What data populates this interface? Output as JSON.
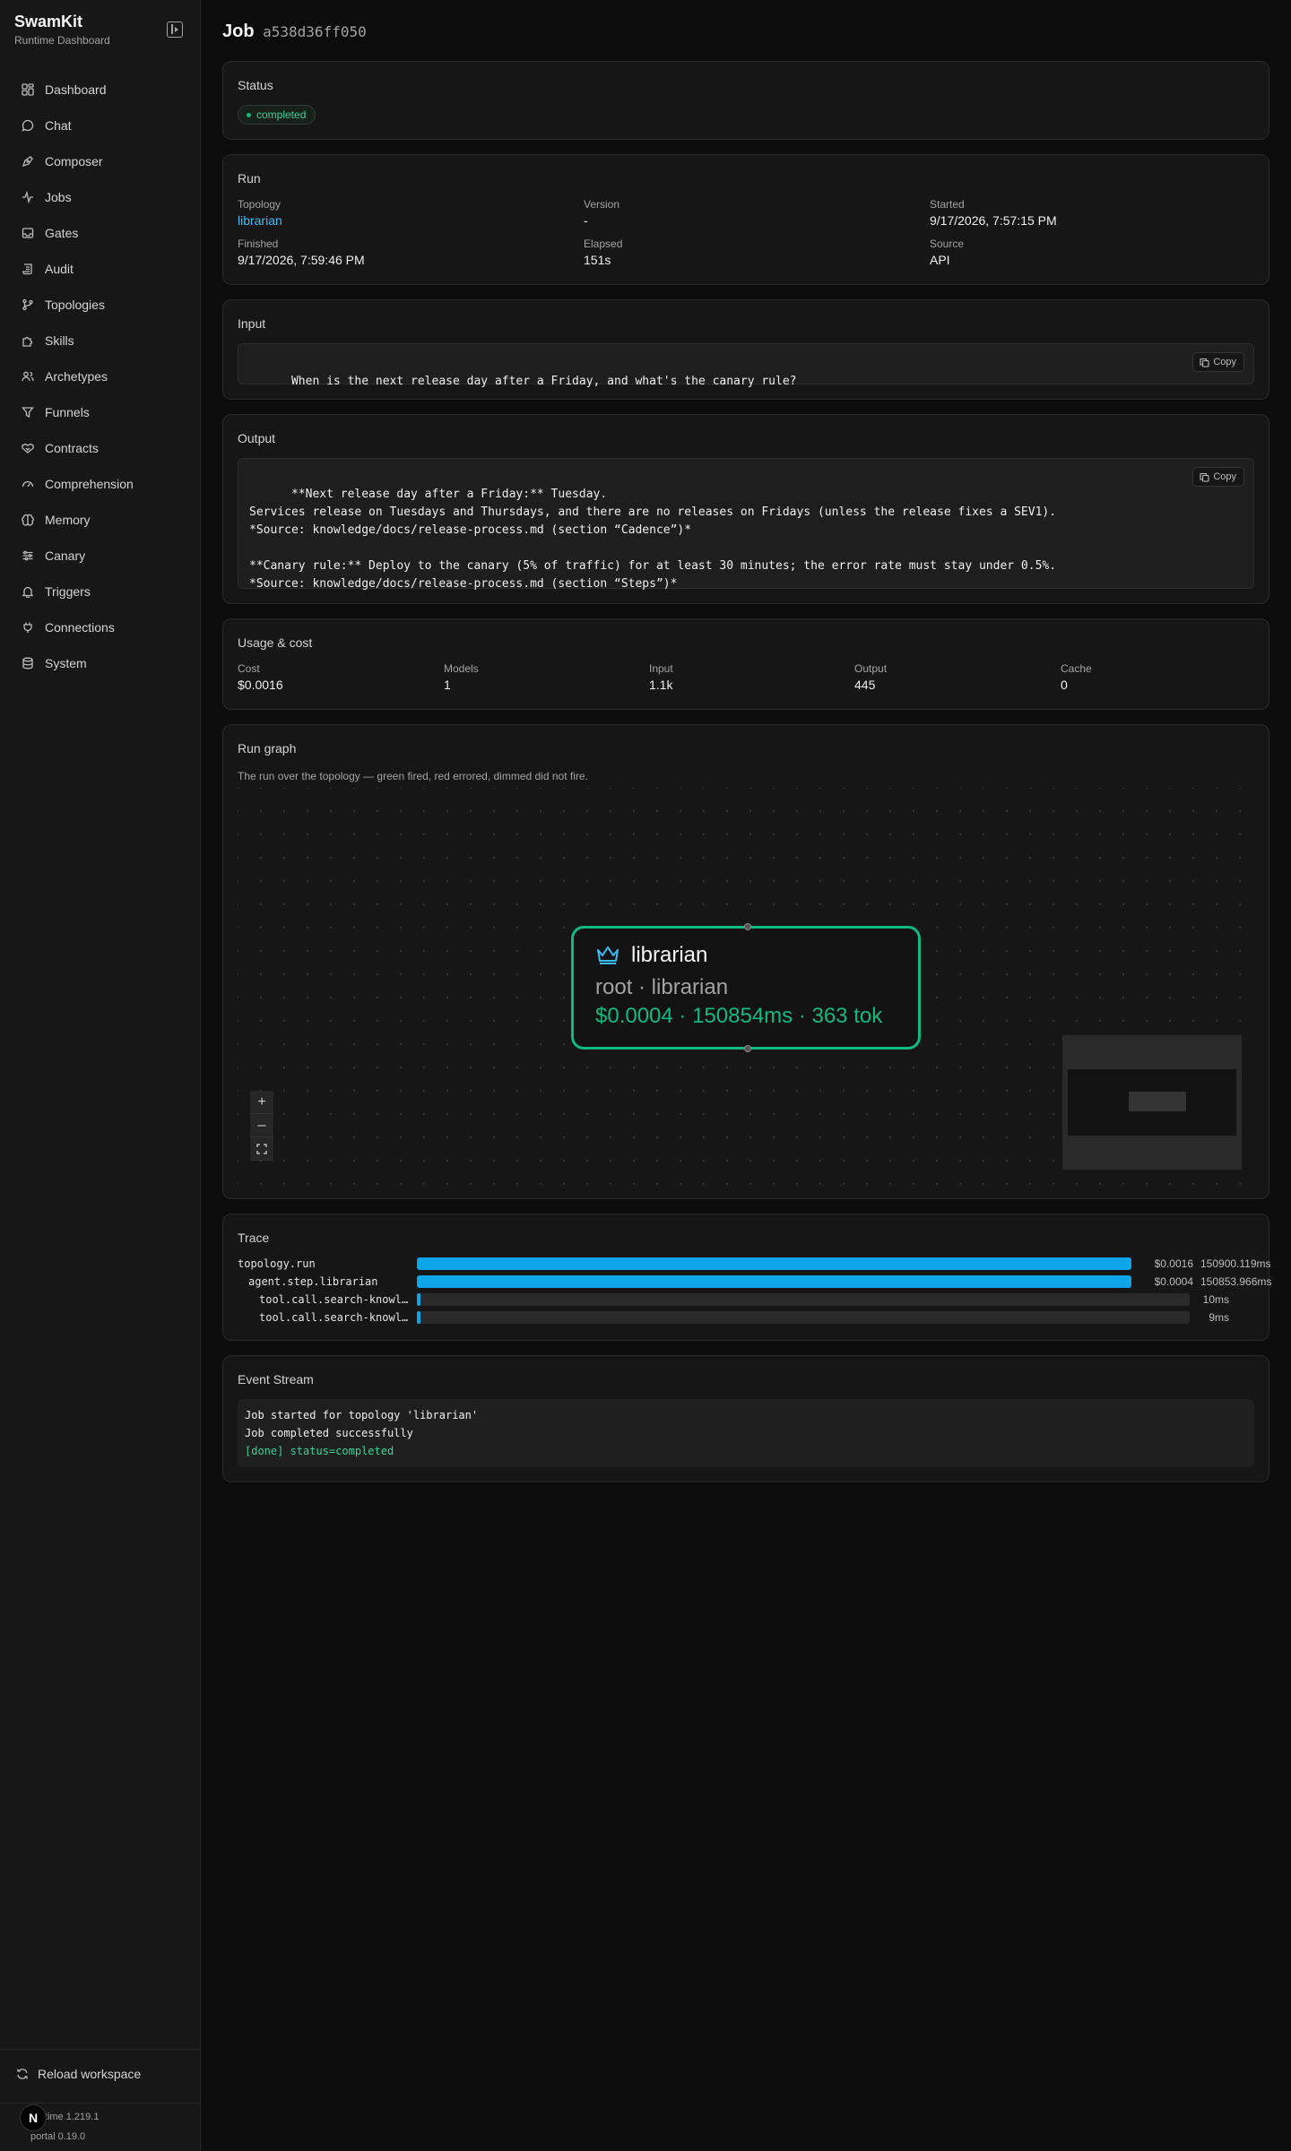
{
  "brand": {
    "title": "SwamKit",
    "subtitle": "Runtime Dashboard"
  },
  "sidebar": {
    "items": [
      {
        "label": "Dashboard",
        "icon": "grid-icon"
      },
      {
        "label": "Chat",
        "icon": "chat-bubble-icon"
      },
      {
        "label": "Composer",
        "icon": "pen-nib-icon"
      },
      {
        "label": "Jobs",
        "icon": "activity-icon"
      },
      {
        "label": "Gates",
        "icon": "inbox-icon"
      },
      {
        "label": "Audit",
        "icon": "scroll-icon"
      },
      {
        "label": "Topologies",
        "icon": "git-branch-icon"
      },
      {
        "label": "Skills",
        "icon": "puzzle-icon"
      },
      {
        "label": "Archetypes",
        "icon": "users-icon"
      },
      {
        "label": "Funnels",
        "icon": "filter-icon"
      },
      {
        "label": "Contracts",
        "icon": "handshake-icon"
      },
      {
        "label": "Comprehension",
        "icon": "gauge-icon"
      },
      {
        "label": "Memory",
        "icon": "brain-icon"
      },
      {
        "label": "Canary",
        "icon": "sliders-icon"
      },
      {
        "label": "Triggers",
        "icon": "bell-icon"
      },
      {
        "label": "Connections",
        "icon": "plug-icon"
      },
      {
        "label": "System",
        "icon": "database-icon"
      }
    ],
    "reload_label": "Reload workspace",
    "runtime_version": "runtime 1.219.1",
    "portal_version": "portal 0.19.0",
    "avatar_initial": "N"
  },
  "job": {
    "heading": "Job",
    "id": "a538d36ff050"
  },
  "status": {
    "title": "Status",
    "value": "completed"
  },
  "run": {
    "title": "Run",
    "topology_label": "Topology",
    "topology": "librarian",
    "version_label": "Version",
    "version": "-",
    "started_label": "Started",
    "started": "9/17/2026, 7:57:15 PM",
    "finished_label": "Finished",
    "finished": "9/17/2026, 7:59:46 PM",
    "elapsed_label": "Elapsed",
    "elapsed": "151s",
    "source_label": "Source",
    "source": "API"
  },
  "input": {
    "title": "Input",
    "text": "When is the next release day after a Friday, and what's the canary rule?",
    "copy_label": "Copy"
  },
  "output": {
    "title": "Output",
    "text": "**Next release day after a Friday:** Tuesday.\nServices release on Tuesdays and Thursdays, and there are no releases on Fridays (unless the release fixes a SEV1).\n*Source: knowledge/docs/release-process.md (section “Cadence”)*\n\n**Canary rule:** Deploy to the canary (5% of traffic) for at least 30 minutes; the error rate must stay under 0.5%.\n*Source: knowledge/docs/release-process.md (section “Steps”)*",
    "copy_label": "Copy"
  },
  "usage": {
    "title": "Usage & cost",
    "cost_label": "Cost",
    "cost": "$0.0016",
    "models_label": "Models",
    "models": "1",
    "input_label": "Input",
    "input": "1.1k",
    "output_label": "Output",
    "output": "445",
    "cache_label": "Cache",
    "cache": "0"
  },
  "graph": {
    "title": "Run graph",
    "caption": "The run over the topology — green fired, red errored, dimmed did not fire.",
    "node": {
      "name": "librarian",
      "subtitle": "root · librarian",
      "metrics": "$0.0004 · 150854ms · 363 tok",
      "status_color": "#10b981",
      "icon": "crown-icon"
    },
    "controls": {
      "zoom_in": "+",
      "zoom_out": "–",
      "fit": "⛶"
    }
  },
  "trace": {
    "title": "Trace",
    "rows": [
      {
        "name": "topology.run",
        "cost": "$0.0016",
        "duration": "150900.119ms",
        "fraction": 1.0
      },
      {
        "name": "agent.step.librarian",
        "cost": "$0.0004",
        "duration": "150853.966ms",
        "fraction": 0.9997
      },
      {
        "name": "tool.call.search-knowledge",
        "cost": "",
        "duration": "10ms",
        "fraction": 0.0001
      },
      {
        "name": "tool.call.search-knowledge",
        "cost": "",
        "duration": "9ms",
        "fraction": 0.0001
      }
    ]
  },
  "events": {
    "title": "Event Stream",
    "lines": [
      "Job started for topology 'librarian'",
      "Job completed successfully",
      "[done] status=completed"
    ]
  }
}
